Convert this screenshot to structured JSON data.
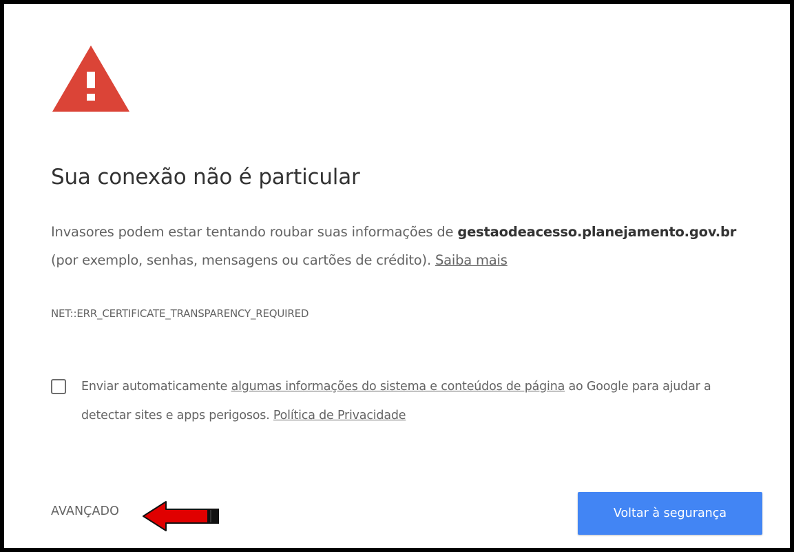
{
  "page": {
    "icon": "warning-triangle-icon",
    "heading": "Sua conexão não é particular",
    "message": {
      "intro": "Invasores podem estar tentando roubar suas informações de ",
      "domain": "gestaodeacesso.planejamento.gov.br",
      "details": " (por exemplo, senhas, mensagens ou cartões de crédito). ",
      "learn_more_link": "Saiba mais"
    },
    "error_code": "NET::ERR_CERTIFICATE_TRANSPARENCY_REQUIRED"
  },
  "report_option": {
    "checked": false,
    "text_before": "Enviar automaticamente ",
    "system_info_link": "algumas informações do sistema e conteúdos de página",
    "text_after": " ao Google para ajudar a detectar sites e apps perigosos. ",
    "privacy_policy_link": "Política de Privacidade"
  },
  "actions": {
    "advanced_label": "AVANÇADO",
    "back_to_safety_label": "Voltar à segurança"
  },
  "annotation": {
    "icon": "red-arrow-pointer-icon"
  },
  "colors": {
    "warning_red": "#db4437",
    "primary_blue": "#4285f4",
    "heading_text": "#333333",
    "body_text": "#646464",
    "annotation_red": "#e00000"
  }
}
